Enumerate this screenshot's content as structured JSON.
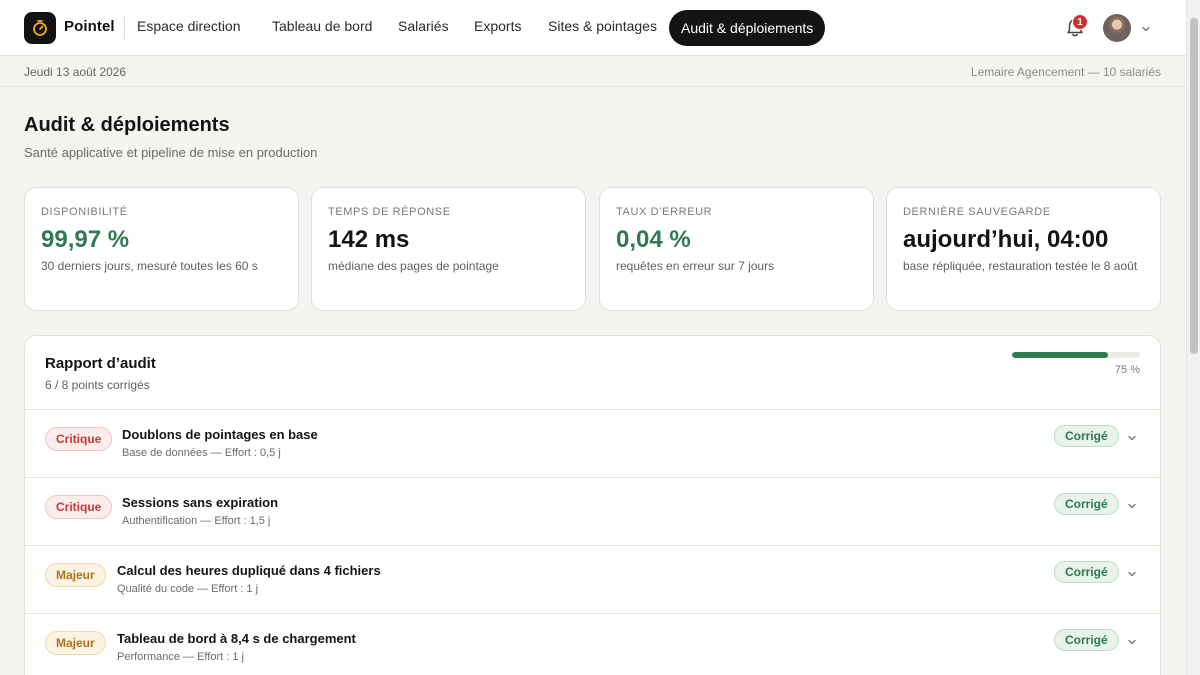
{
  "app": {
    "brand": "Pointel",
    "nav": [
      {
        "label": "Espace direction"
      },
      {
        "label": "Tableau de bord"
      },
      {
        "label": "Salariés"
      },
      {
        "label": "Exports"
      },
      {
        "label": "Sites & pointages"
      },
      {
        "label": "Audit & déploiements",
        "active": true
      }
    ],
    "notifications_count": "1",
    "icons": {
      "logo": "stopwatch-icon",
      "bell": "bell-icon",
      "chevron": "chevron-down-icon"
    }
  },
  "subbar": {
    "date": "Jeudi 13 août 2026",
    "company": "Lemaire Agencement — 10 salariés"
  },
  "page": {
    "title": "Audit & déploiements",
    "subtitle": "Santé applicative et pipeline de mise en production"
  },
  "metrics": [
    {
      "label": "Disponibilité",
      "value": "99,97 %",
      "desc": "30 derniers jours, mesuré toutes les 60 s",
      "color": "#2f7a4f"
    },
    {
      "label": "Temps de réponse",
      "value": "142 ms",
      "desc": "médiane des pages de pointage",
      "color": "#141414"
    },
    {
      "label": "Taux d’erreur",
      "value": "0,04 %",
      "desc": "requêtes en erreur sur 7 jours",
      "color": "#2f7a4f"
    },
    {
      "label": "Dernière sauvegarde",
      "value": "aujourd’hui, 04:00",
      "desc": "base répliquée, restauration testée le 8 août",
      "color": "#141414"
    }
  ],
  "audit": {
    "title": "Rapport d’audit",
    "summary": "6 / 8 points corrigés",
    "progress_label": "75 %",
    "progress_fraction": 0.75,
    "items": [
      {
        "severity": "Critique",
        "title": "Doublons de pointages en base",
        "meta": "Base de données — Effort : 0,5 j",
        "status": "Corrigé"
      },
      {
        "severity": "Critique",
        "title": "Sessions sans expiration",
        "meta": "Authentification — Effort : 1,5 j",
        "status": "Corrigé"
      },
      {
        "severity": "Majeur",
        "title": "Calcul des heures dupliqué dans 4 fichiers",
        "meta": "Qualité du code — Effort : 1 j",
        "status": "Corrigé"
      },
      {
        "severity": "Majeur",
        "title": "Tableau de bord à 8,4 s de chargement",
        "meta": "Performance — Effort : 1 j",
        "status": "Corrigé"
      }
    ]
  }
}
